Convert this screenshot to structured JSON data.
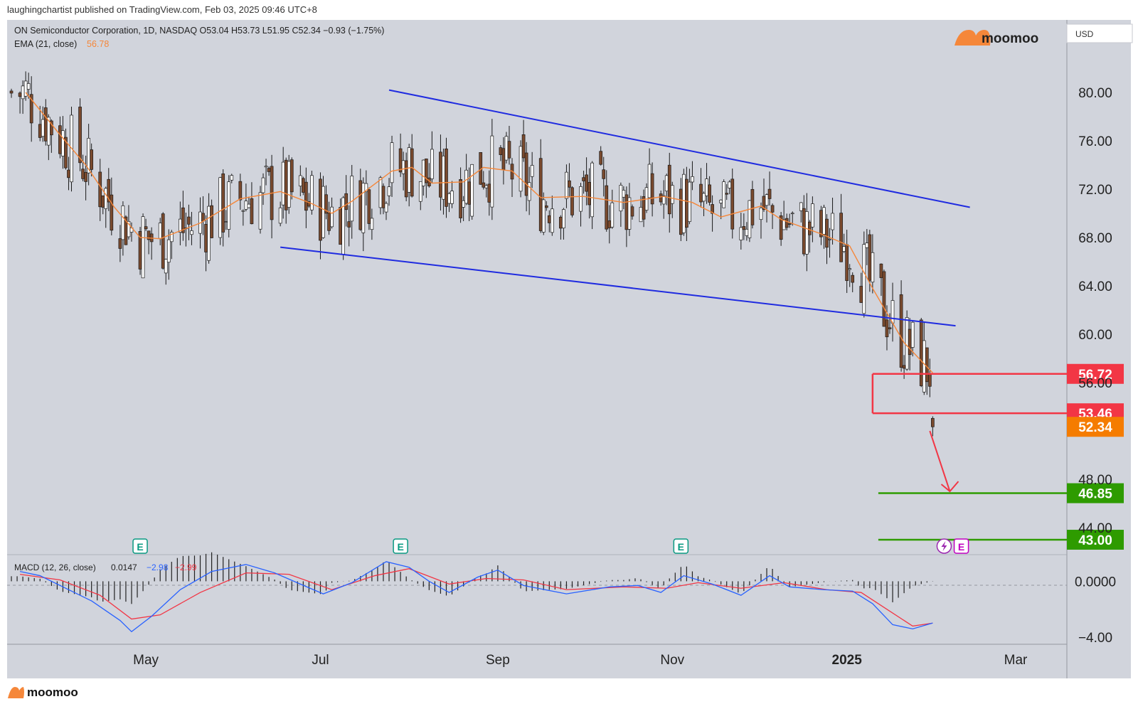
{
  "header": {
    "publisher": "laughingchartist published on TradingView.com, Feb 03, 2025 09:46 UTC+8"
  },
  "symbol": {
    "line": "ON Semiconductor Corporation, 1D, NASDAQ  O53.04  H53.73  L51.95  C52.34  −0.93 (−1.75%)",
    "ema_label": "EMA (21, close)",
    "ema_value": "56.78"
  },
  "brand": {
    "name": "moomoo"
  },
  "colors": {
    "background": "#d1d4dc",
    "up_candle": "#ffffff",
    "down_candle": "#7a4a2e",
    "ema": "#f5873a",
    "channel": "#1f2be0",
    "level_red": "#f23645",
    "last_price": "#f57c00",
    "target_green": "#2e9b00",
    "macd": "#2962ff",
    "signal": "#f23645"
  },
  "chart_data": [
    {
      "type": "candlestick",
      "title": "ON Semiconductor Corporation, 1D, NASDAQ",
      "currency": "USD",
      "ylim": [
        42,
        86
      ],
      "y_ticks": [
        "80.00",
        "76.00",
        "72.00",
        "68.00",
        "64.00",
        "60.00",
        "56.00",
        "48.00",
        "44.00"
      ],
      "x_ticks": [
        "May",
        "Jul",
        "Sep",
        "Nov",
        "2025",
        "Mar"
      ],
      "ohlc_last": {
        "open": 53.04,
        "high": 53.73,
        "low": 51.95,
        "close": 52.34,
        "change": -0.93,
        "change_pct": -1.75
      },
      "ema_21": [
        [
          "2024-03-20",
          80.0
        ],
        [
          "2024-04-01",
          76.5
        ],
        [
          "2024-04-10",
          74.0
        ],
        [
          "2024-04-20",
          70.5
        ],
        [
          "2024-04-29",
          68.0
        ],
        [
          "2024-05-06",
          67.9
        ],
        [
          "2024-05-20",
          69.2
        ],
        [
          "2024-06-03",
          71.2
        ],
        [
          "2024-06-17",
          71.8
        ],
        [
          "2024-06-28",
          70.8
        ],
        [
          "2024-07-05",
          70.0
        ],
        [
          "2024-07-12",
          71.0
        ],
        [
          "2024-07-26",
          73.5
        ],
        [
          "2024-08-02",
          73.8
        ],
        [
          "2024-08-09",
          72.5
        ],
        [
          "2024-08-20",
          72.6
        ],
        [
          "2024-08-27",
          73.8
        ],
        [
          "2024-09-06",
          73.5
        ],
        [
          "2024-09-16",
          71.3
        ],
        [
          "2024-10-01",
          71.4
        ],
        [
          "2024-10-15",
          70.9
        ],
        [
          "2024-10-29",
          71.4
        ],
        [
          "2024-11-08",
          70.9
        ],
        [
          "2024-11-18",
          69.7
        ],
        [
          "2024-12-02",
          70.6
        ],
        [
          "2024-12-09",
          69.5
        ],
        [
          "2024-12-23",
          68.3
        ],
        [
          "2025-01-02",
          67.3
        ],
        [
          "2025-01-10",
          63.8
        ],
        [
          "2025-01-21",
          59.3
        ],
        [
          "2025-01-31",
          56.8
        ]
      ],
      "channel_upper": [
        [
          "2024-07-25",
          80.2
        ],
        [
          "2025-02-13",
          70.5
        ]
      ],
      "channel_lower": [
        [
          "2024-06-17",
          67.2
        ],
        [
          "2025-02-08",
          60.7
        ]
      ],
      "levels": [
        {
          "label": "56.72",
          "value": 56.72,
          "color": "#f23645"
        },
        {
          "label": "53.46",
          "value": 53.46,
          "color": "#f23645"
        },
        {
          "label": "52.34",
          "value": 52.34,
          "color": "#f57c00"
        },
        {
          "label": "46.85",
          "value": 46.85,
          "color": "#2e9b00"
        },
        {
          "label": "43.00",
          "value": 43.0,
          "color": "#2e9b00"
        }
      ],
      "projection_arrow": {
        "from": [
          "2025-01-30",
          52.0
        ],
        "to": [
          "2025-02-06",
          47.0
        ]
      },
      "earnings_markers": [
        "2024-04-29",
        "2024-07-29",
        "2024-11-04",
        "2025-02-10"
      ],
      "earnings_label": "E"
    },
    {
      "type": "line",
      "title": "MACD (12, 26, close)",
      "values_label": [
        "0.0147",
        "−2.98",
        "−2.99"
      ],
      "ylim": [
        -4.5,
        1.8
      ],
      "y_ticks": [
        "0.0000",
        "−4.00"
      ],
      "macd": [
        [
          "2024-03-18",
          0.7
        ],
        [
          "2024-03-25",
          0.4
        ],
        [
          "2024-04-01",
          -0.3
        ],
        [
          "2024-04-12",
          -1.4
        ],
        [
          "2024-04-22",
          -2.8
        ],
        [
          "2024-04-26",
          -3.6
        ],
        [
          "2024-05-03",
          -2.5
        ],
        [
          "2024-05-13",
          -0.6
        ],
        [
          "2024-05-24",
          0.7
        ],
        [
          "2024-06-05",
          1.2
        ],
        [
          "2024-06-15",
          0.6
        ],
        [
          "2024-06-24",
          -0.2
        ],
        [
          "2024-07-02",
          -0.9
        ],
        [
          "2024-07-12",
          -0.1
        ],
        [
          "2024-07-24",
          1.4
        ],
        [
          "2024-08-01",
          1.0
        ],
        [
          "2024-08-08",
          0.0
        ],
        [
          "2024-08-15",
          -0.8
        ],
        [
          "2024-08-25",
          0.3
        ],
        [
          "2024-09-01",
          0.8
        ],
        [
          "2024-09-10",
          -0.3
        ],
        [
          "2024-09-25",
          -0.9
        ],
        [
          "2024-10-10",
          -0.4
        ],
        [
          "2024-10-20",
          -0.3
        ],
        [
          "2024-10-28",
          -0.8
        ],
        [
          "2024-11-05",
          0.4
        ],
        [
          "2024-11-15",
          -0.2
        ],
        [
          "2024-11-25",
          -1.0
        ],
        [
          "2024-12-05",
          0.4
        ],
        [
          "2024-12-12",
          -0.4
        ],
        [
          "2024-12-24",
          -0.6
        ],
        [
          "2025-01-03",
          -0.7
        ],
        [
          "2025-01-10",
          -1.6
        ],
        [
          "2025-01-17",
          -3.1
        ],
        [
          "2025-01-24",
          -3.4
        ],
        [
          "2025-01-31",
          -2.98
        ]
      ],
      "signal": [
        [
          "2024-03-18",
          0.5
        ],
        [
          "2024-04-01",
          0.1
        ],
        [
          "2024-04-15",
          -1.0
        ],
        [
          "2024-04-26",
          -2.7
        ],
        [
          "2024-05-06",
          -2.4
        ],
        [
          "2024-05-20",
          -0.8
        ],
        [
          "2024-06-05",
          0.6
        ],
        [
          "2024-06-20",
          0.5
        ],
        [
          "2024-07-05",
          -0.6
        ],
        [
          "2024-07-20",
          0.4
        ],
        [
          "2024-08-01",
          0.9
        ],
        [
          "2024-08-15",
          -0.2
        ],
        [
          "2024-08-28",
          0.2
        ],
        [
          "2024-09-10",
          0.1
        ],
        [
          "2024-09-25",
          -0.6
        ],
        [
          "2024-10-15",
          -0.4
        ],
        [
          "2024-10-30",
          -0.5
        ],
        [
          "2024-11-10",
          -0.1
        ],
        [
          "2024-11-25",
          -0.5
        ],
        [
          "2024-12-10",
          -0.1
        ],
        [
          "2024-12-25",
          -0.6
        ],
        [
          "2025-01-06",
          -0.8
        ],
        [
          "2025-01-15",
          -2.0
        ],
        [
          "2025-01-24",
          -3.2
        ],
        [
          "2025-01-31",
          -2.99
        ]
      ]
    }
  ]
}
